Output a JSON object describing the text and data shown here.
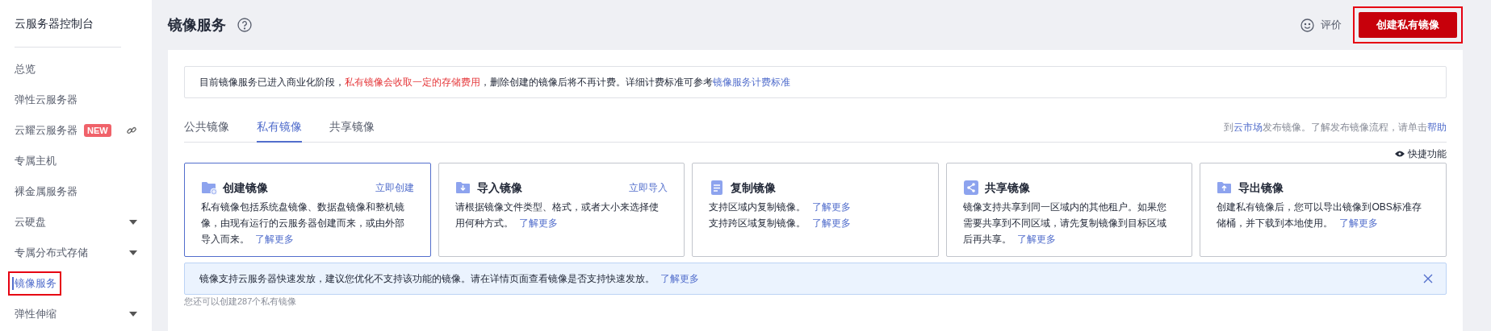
{
  "sidebar": {
    "title": "云服务器控制台",
    "items": [
      {
        "label": "总览",
        "selected": false,
        "highlighted": false
      },
      {
        "label": "弹性云服务器",
        "selected": false,
        "highlighted": false
      },
      {
        "label": "云耀云服务器",
        "badge": "NEW",
        "external": true,
        "selected": false,
        "highlighted": false
      },
      {
        "label": "专属主机",
        "selected": false,
        "highlighted": false
      },
      {
        "label": "裸金属服务器",
        "selected": false,
        "highlighted": false
      },
      {
        "label": "云硬盘",
        "expandable": true,
        "selected": false,
        "highlighted": false
      },
      {
        "label": "专属分布式存储",
        "expandable": true,
        "selected": false,
        "highlighted": false
      },
      {
        "label": "镜像服务",
        "selected": true,
        "highlighted": true
      },
      {
        "label": "弹性伸缩",
        "expandable": true,
        "selected": false,
        "highlighted": false
      }
    ]
  },
  "header": {
    "title": "镜像服务",
    "feedback": "评价",
    "create_button": {
      "label": "创建私有镜像",
      "highlighted": true
    }
  },
  "notice": [
    {
      "kind": "normal",
      "text": "目前镜像服务已进入商业化阶段，"
    },
    {
      "kind": "warning",
      "text": "私有镜像会收取一定的存储费用"
    },
    {
      "kind": "normal",
      "text": "，删除创建的镜像后将不再计费。详细计费标准可参考"
    },
    {
      "kind": "link",
      "text": "镜像服务计费标准"
    }
  ],
  "tabs": [
    {
      "label": "公共镜像",
      "selected": false
    },
    {
      "label": "私有镜像",
      "selected": true
    },
    {
      "label": "共享镜像",
      "selected": false
    }
  ],
  "publish_hint": [
    {
      "kind": "normal",
      "text": "到"
    },
    {
      "kind": "link",
      "text": "云市场"
    },
    {
      "kind": "normal",
      "text": "发布镜像。了解发布镜像流程，请单击"
    },
    {
      "kind": "link",
      "text": "帮助"
    }
  ],
  "shortcuts_toggle": "快捷功能",
  "cards": [
    {
      "kind": "create",
      "title": "创建镜像",
      "action": "立即创建",
      "selected": true,
      "paragraphs": [
        {
          "text": "私有镜像包括系统盘镜像、数据盘镜像和整机镜像，由现有运行的云服务器创建而来，或由外部导入而来。",
          "link": "了解更多"
        }
      ]
    },
    {
      "kind": "import",
      "title": "导入镜像",
      "action": "立即导入",
      "selected": false,
      "paragraphs": [
        {
          "text": "请根据镜像文件类型、格式，或者大小来选择使用何种方式。",
          "link": "了解更多"
        }
      ]
    },
    {
      "kind": "copy",
      "title": "复制镜像",
      "selected": false,
      "paragraphs": [
        {
          "text": "支持区域内复制镜像。",
          "link": "了解更多"
        },
        {
          "text": "支持跨区域复制镜像。",
          "link": "了解更多"
        }
      ]
    },
    {
      "kind": "share",
      "title": "共享镜像",
      "selected": false,
      "paragraphs": [
        {
          "text": "镜像支持共享到同一区域内的其他租户。如果您需要共享到不同区域，请先复制镜像到目标区域后再共享。",
          "link": "了解更多"
        }
      ]
    },
    {
      "kind": "export",
      "title": "导出镜像",
      "selected": false,
      "paragraphs": [
        {
          "text": "创建私有镜像后，您可以导出镜像到OBS标准存储桶，并下载到本地使用。",
          "link": "了解更多"
        }
      ]
    }
  ],
  "tip": {
    "text": "镜像支持云服务器快速发放，建议您优化不支持该功能的镜像。请在详情页面查看镜像是否支持快速发放。",
    "link": "了解更多"
  },
  "quota_text": "您还可以创建287个私有镜像"
}
